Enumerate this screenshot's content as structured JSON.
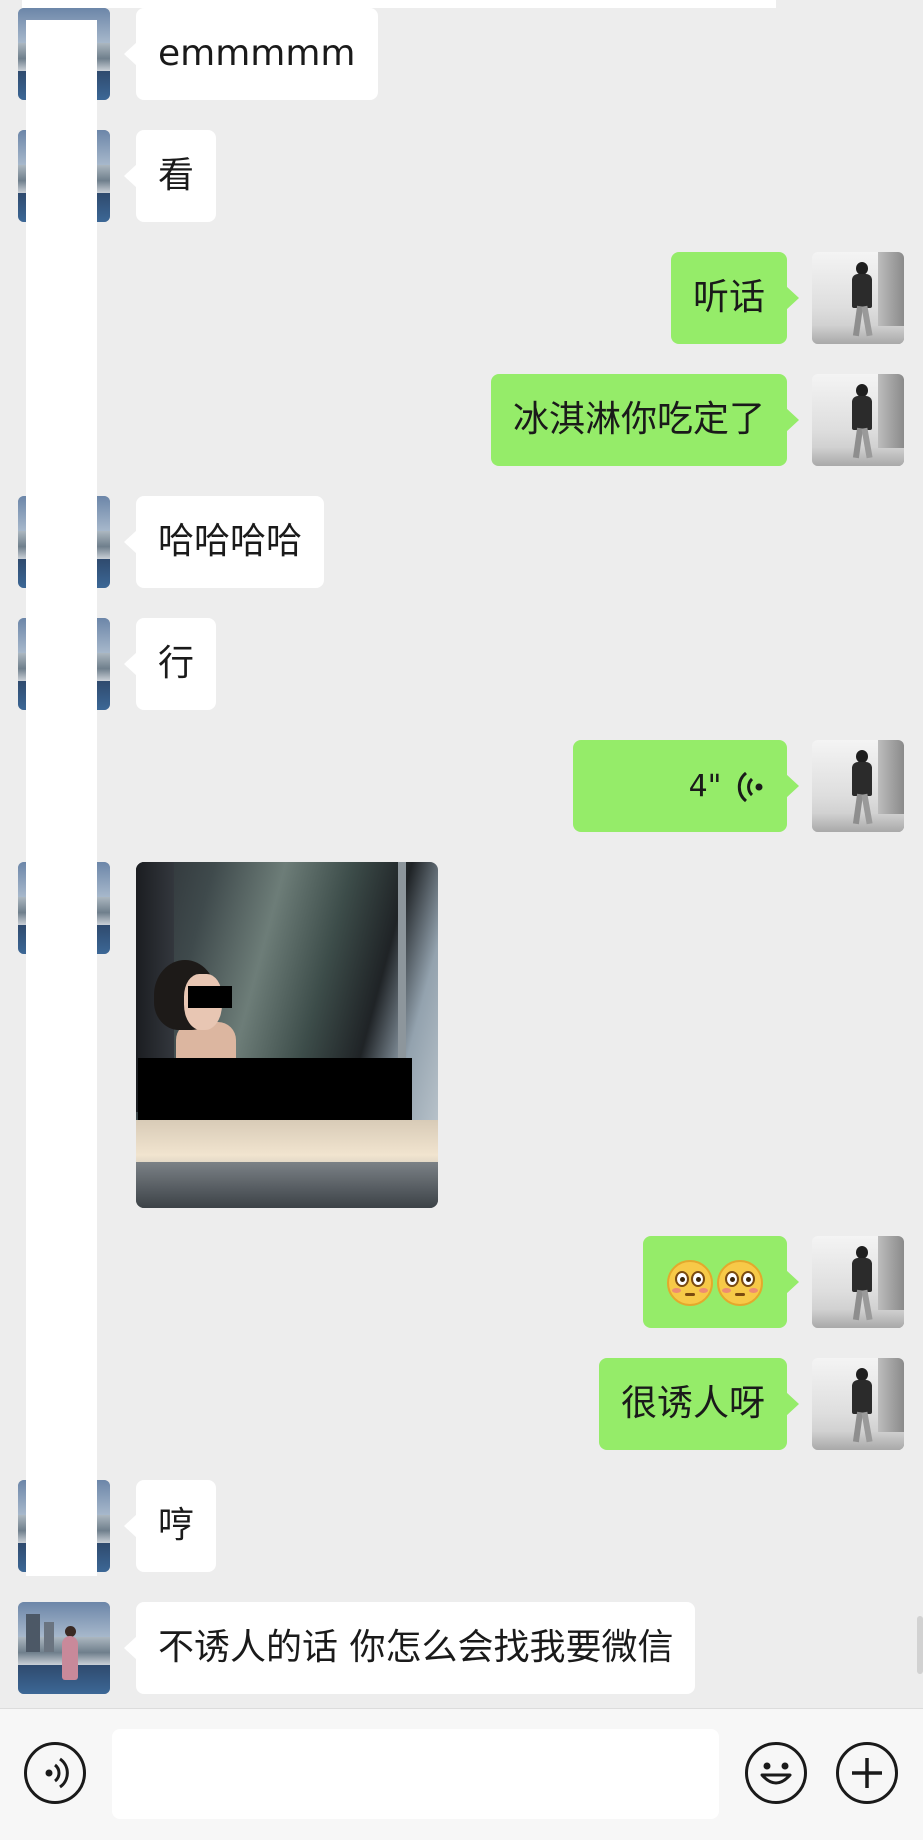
{
  "messages": [
    {
      "id": "m1",
      "side": "left",
      "type": "text",
      "text": "emmmmm"
    },
    {
      "id": "m2",
      "side": "left",
      "type": "text",
      "text": "看"
    },
    {
      "id": "m3",
      "side": "right",
      "type": "text",
      "text": "听话"
    },
    {
      "id": "m4",
      "side": "right",
      "type": "text",
      "text": "冰淇淋你吃定了"
    },
    {
      "id": "m5",
      "side": "left",
      "type": "text",
      "text": "哈哈哈哈"
    },
    {
      "id": "m6",
      "side": "left",
      "type": "text",
      "text": "行"
    },
    {
      "id": "m7",
      "side": "right",
      "type": "voice",
      "duration": "4\""
    },
    {
      "id": "m8",
      "side": "left",
      "type": "image",
      "icon": "photo-bathtub"
    },
    {
      "id": "m9",
      "side": "right",
      "type": "emoji",
      "icons": [
        "flushed-face-icon",
        "flushed-face-icon"
      ]
    },
    {
      "id": "m10",
      "side": "right",
      "type": "text",
      "text": "很诱人呀"
    },
    {
      "id": "m11",
      "side": "left",
      "type": "text",
      "text": "哼"
    },
    {
      "id": "m12",
      "side": "left",
      "type": "text",
      "text": "不诱人的话 你怎么会找我要微信"
    }
  ],
  "input_bar": {
    "voice_icon": "voice-input-icon",
    "text_value": "",
    "emoji_icon": "smiley-face-icon",
    "plus_icon": "plus-icon"
  },
  "colors": {
    "background": "#ededed",
    "bubble_self": "#95ec69",
    "bubble_other": "#ffffff"
  }
}
